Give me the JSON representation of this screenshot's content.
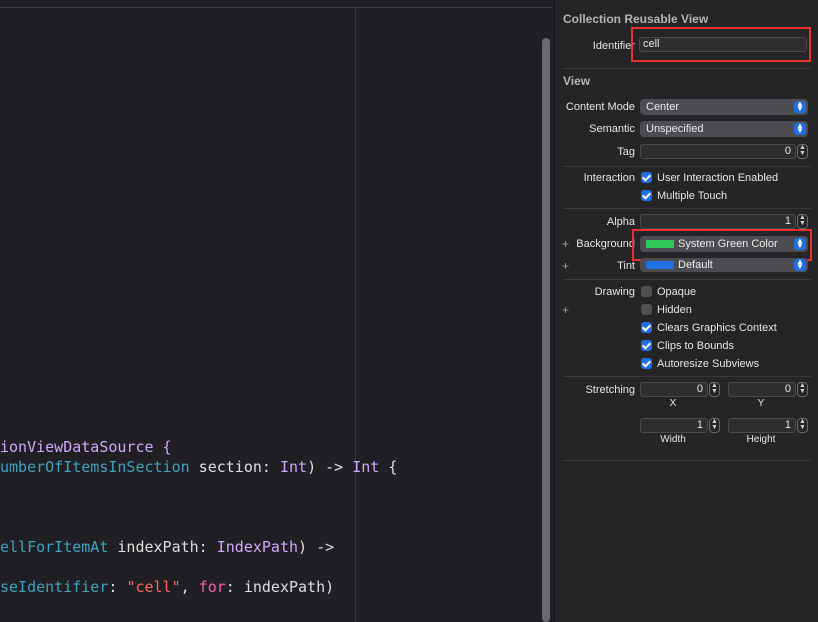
{
  "editor": {
    "lines": [
      [
        {
          "t": "ionViewDataSource {",
          "c": "pl-ty"
        }
      ],
      [
        {
          "t": "umberOfItemsInSection",
          "c": "fn"
        },
        {
          "t": " section: ",
          "c": "pl"
        },
        {
          "t": "Int",
          "c": "ty"
        },
        {
          "t": ") -> ",
          "c": "pl"
        },
        {
          "t": "Int",
          "c": "ty"
        },
        {
          "t": " {",
          "c": "pl"
        }
      ],
      [
        {
          "t": "ellForItemAt",
          "c": "fn"
        },
        {
          "t": " indexPath: ",
          "c": "pl"
        },
        {
          "t": "IndexPath",
          "c": "ty"
        },
        {
          "t": ") ->",
          "c": "pl"
        }
      ],
      [
        {
          "t": "seIdentifier",
          "c": "fn"
        },
        {
          "t": ": ",
          "c": "pl"
        },
        {
          "t": "\"cell\"",
          "c": "str"
        },
        {
          "t": ", ",
          "c": "pl"
        },
        {
          "t": "for",
          "c": "kw"
        },
        {
          "t": ": indexPath)",
          "c": "pl"
        }
      ]
    ]
  },
  "inspector": {
    "reusable_title": "Collection Reusable View",
    "identifier_label": "Identifier",
    "identifier_value": "cell",
    "view_title": "View",
    "content_mode_label": "Content Mode",
    "content_mode_value": "Center",
    "semantic_label": "Semantic",
    "semantic_value": "Unspecified",
    "tag_label": "Tag",
    "tag_value": "0",
    "interaction_label": "Interaction",
    "user_interaction_label": "User Interaction Enabled",
    "multiple_touch_label": "Multiple Touch",
    "alpha_label": "Alpha",
    "alpha_value": "1",
    "background_label": "Background",
    "background_value": "System Green Color",
    "background_color": "#30c75b",
    "tint_label": "Tint",
    "tint_value": "Default",
    "tint_color": "#1f6fe0",
    "drawing_label": "Drawing",
    "opaque_label": "Opaque",
    "hidden_label": "Hidden",
    "clears_label": "Clears Graphics Context",
    "clips_label": "Clips to Bounds",
    "autoresize_label": "Autoresize Subviews",
    "stretching_label": "Stretching",
    "stretch_x_value": "0",
    "stretch_y_value": "0",
    "x_label": "X",
    "y_label": "Y",
    "width_value": "1",
    "height_value": "1",
    "width_label": "Width",
    "height_label": "Height",
    "plus": "+",
    "checks": {
      "user_interaction": true,
      "multiple_touch": true,
      "opaque": false,
      "hidden": false,
      "clears": true,
      "clips": true,
      "autoresize": true
    }
  }
}
